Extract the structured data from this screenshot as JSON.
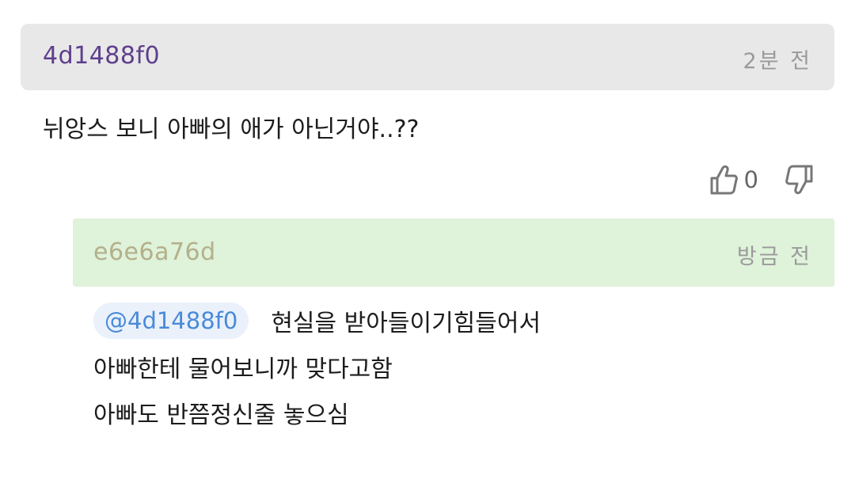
{
  "comment": {
    "author": "4d1488f0",
    "time": "2분 전",
    "text": "뉘앙스 보니 아빠의 애가 아닌거야..??",
    "like_count": "0",
    "like_icon": "thumbs-up-icon",
    "dislike_icon": "thumbs-down-icon"
  },
  "reply": {
    "author": "e6e6a76d",
    "time": "방금 전",
    "mention": "@4d1488f0",
    "lines": [
      "현실을 받아들이기힘들어서",
      "아빠한테 물어보니까 맞다고함",
      "아빠도 반쯤정신줄 놓으심"
    ]
  },
  "colors": {
    "comment_header_bg": "#e8e8e8",
    "comment_author": "#5e3f8c",
    "reply_header_bg": "#dff2da",
    "reply_author": "#b3b08a",
    "mention_text": "#4a8ad8",
    "mention_bg": "#eaf1fb",
    "timestamp": "#9a9a9a"
  }
}
